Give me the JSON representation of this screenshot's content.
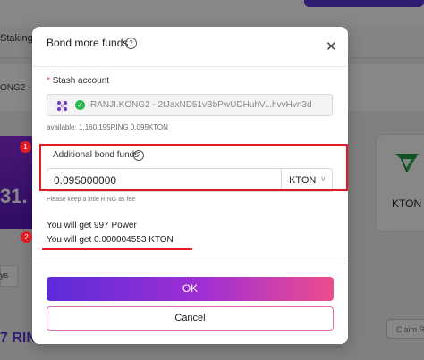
{
  "background": {
    "tab_staking": "Staking",
    "account_short": "ONG2 - 2",
    "card_value": "31.",
    "kton_label": "KTON",
    "ys_label": "ys",
    "rin_text": "7 RIN",
    "claim_label": "Claim R"
  },
  "modal": {
    "title": "Bond more funds",
    "stash": {
      "label": "Stash account",
      "required_mark": "*",
      "value": "RANJI.KONG2 - 2tJaxND51vBbPwUDHuhV...hvvHvn3d",
      "available": "available:   1,160.195RING   0.095KTON"
    },
    "bond": {
      "label": "Additional bond funds",
      "amount": "0.095000000",
      "unit": "KTON",
      "fee_note": "Please keep a little RING as fee"
    },
    "result": {
      "power": "You will get 997 Power",
      "kton": "You will get 0.000004553 KTON"
    },
    "ok_label": "OK",
    "cancel_label": "Cancel",
    "annotations": {
      "badge1": "1",
      "badge2": "2"
    }
  },
  "colors": {
    "accent": "#5b2bd8",
    "highlight_red": "#e01b24",
    "verified_green": "#2db84d",
    "button_gradient_end": "#ee4d8c"
  }
}
